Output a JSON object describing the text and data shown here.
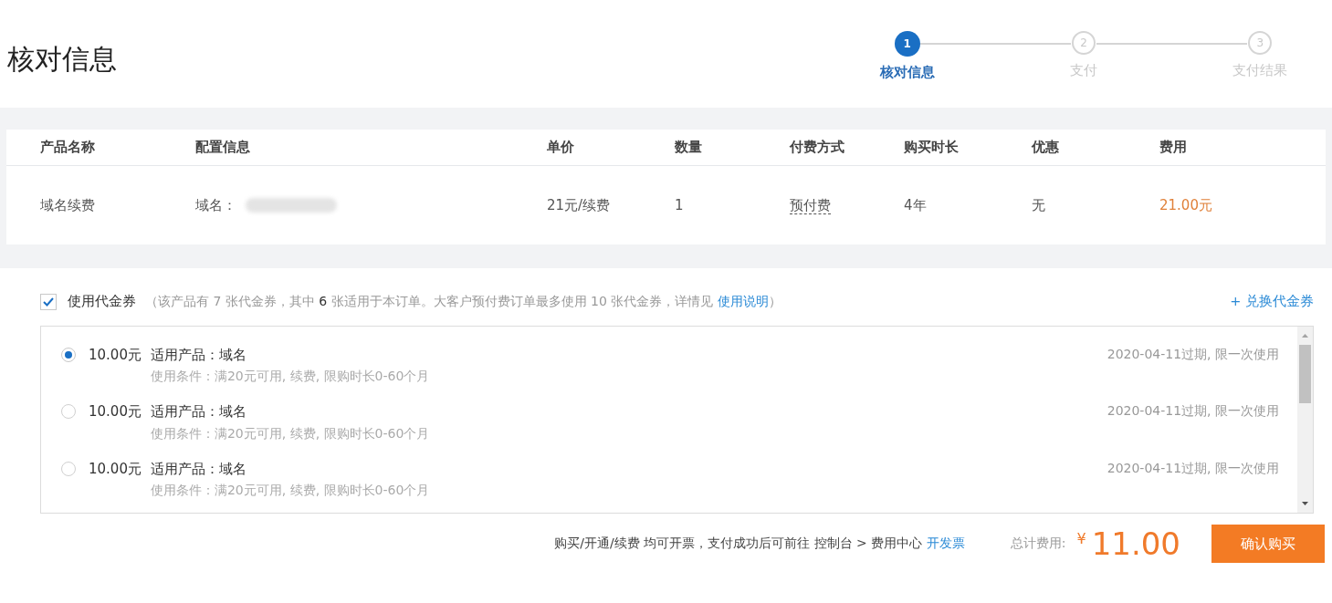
{
  "page_title": "核对信息",
  "steps": [
    {
      "number": "1",
      "label": "核对信息",
      "selected": true
    },
    {
      "number": "2",
      "label": "支付",
      "selected": false
    },
    {
      "number": "3",
      "label": "支付结果",
      "selected": false
    }
  ],
  "table": {
    "columns": [
      "产品名称",
      "配置信息",
      "单价",
      "数量",
      "付费方式",
      "购买时长",
      "优惠",
      "费用"
    ],
    "rows": [
      {
        "product": "域名续费",
        "config_label": "域名：",
        "unit_price": "21元/续费",
        "quantity": "1",
        "payment": "预付费",
        "duration": "4年",
        "discount": "无",
        "cost": "21.00元"
      }
    ]
  },
  "voucher": {
    "checked": true,
    "label": "使用代金券",
    "note_before": "（该产品有 7 张代金券，其中 **6** 张适用于本订单。大客户预付费订单最多使用 10 张代金券，详情见 ",
    "note_link": "使用说明",
    "note_after": "）",
    "exchange_link": "+ 兑换代金券",
    "items": [
      {
        "amount": "10.00元",
        "product": "适用产品：域名",
        "condition": "使用条件：满20元可用, 续费, 限购时长0-60个月",
        "expiry": "2020-04-11过期, 限一次使用",
        "selected": true
      },
      {
        "amount": "10.00元",
        "product": "适用产品：域名",
        "condition": "使用条件：满20元可用, 续费, 限购时长0-60个月",
        "expiry": "2020-04-11过期, 限一次使用",
        "selected": false
      },
      {
        "amount": "10.00元",
        "product": "适用产品：域名",
        "condition": "使用条件：满20元可用, 续费, 限购时长0-60个月",
        "expiry": "2020-04-11过期, 限一次使用",
        "selected": false
      }
    ]
  },
  "footer": {
    "invoice_note": "购买/开通/续费 均可开票，支付成功后可前往 控制台 > 费用中心",
    "invoice_link": "开发票",
    "total_label": "总计费用:",
    "currency": "¥",
    "total": "11.00",
    "confirm_button": "确认购买"
  }
}
